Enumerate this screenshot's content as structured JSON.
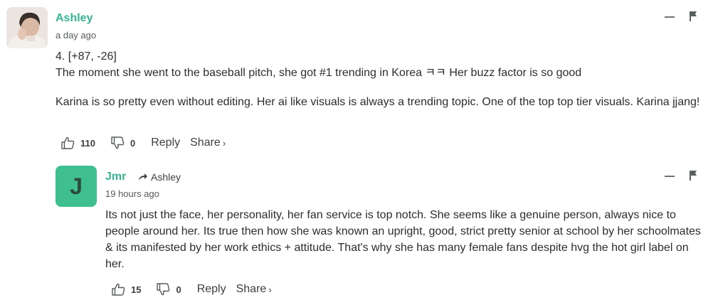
{
  "comments": [
    {
      "author": "Ashley",
      "time": "a day ago",
      "paragraphs": [
        "4. [+87, -26]",
        "The moment she went to the baseball pitch, she got #1 trending in Korea ㅋㅋ Her buzz factor is so good"
      ],
      "paragraphs2": [
        "Karina is so pretty even without editing. Her ai like visuals is always a trending topic. One of the top top tier visuals. Karina jjang!"
      ],
      "likes": "110",
      "dislikes": "0",
      "reply_label": "Reply",
      "share_label": "Share",
      "share_chevron": "›"
    },
    {
      "author": "Jmr",
      "avatar_letter": "J",
      "reply_to": "Ashley",
      "time": "19 hours ago",
      "paragraphs": [
        "Its not just the face, her personality, her fan service is top notch. She seems like a genuine person, always nice to people around her. Its true then how she was known an upright, good, strict pretty senior at school by her schoolmates & its manifested by her work ethics + attitude. That's why she has many female fans despite hvg the hot girl label on her."
      ],
      "likes": "15",
      "dislikes": "0",
      "reply_label": "Reply",
      "share_label": "Share",
      "share_chevron": "›"
    }
  ],
  "colors": {
    "author": "#35b591",
    "avatar_letter_bg": "#3fbf8f",
    "text": "#2a2e2e",
    "muted": "#555b5b"
  }
}
